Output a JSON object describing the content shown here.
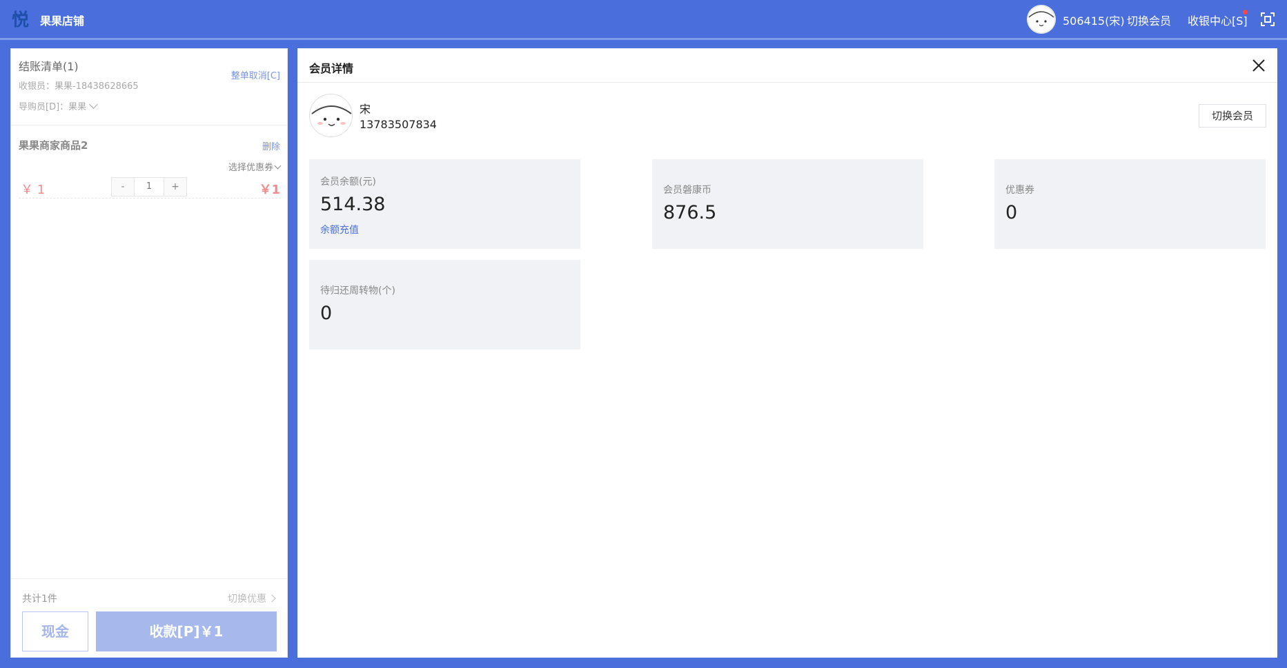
{
  "topbar": {
    "logo_glyph": "悦",
    "shop_name": "果果店铺",
    "user": "506415(宋)",
    "switch_member": "切换会员",
    "cashier_center": "收银中心[S]"
  },
  "checkout": {
    "title": "结账清单(1)",
    "cancel_all": "整单取消[C]",
    "cashier": "收银员：果果-18438628665",
    "guide": "导购员[D]：果果",
    "item": {
      "name": "果果商家商品2",
      "delete": "删除",
      "coupon": "选择优惠券",
      "price": "￥ 1",
      "minus": "-",
      "quantity": "1",
      "plus": "+",
      "subtotal": "￥1"
    },
    "total_count": "共计1件",
    "switch_promo": "切换优惠",
    "cash_button": "现金",
    "pay_button": "收款[P]￥1"
  },
  "member_detail": {
    "title": "会员详情",
    "name": "宋",
    "phone": "13783507834",
    "switch_button": "切换会员",
    "cards": [
      {
        "label": "会员余额(元)",
        "value": "514.38",
        "link": "余额充值"
      },
      {
        "label": "会员磐康币",
        "value": "876.5"
      },
      {
        "label": "优惠券",
        "value": "0"
      },
      {
        "label": "待归还周转物(个)",
        "value": "0"
      }
    ]
  },
  "colors": {
    "brand_blue": "#4a6fdc",
    "price_red": "#f28b8b",
    "pay_button": "#a7b8ec",
    "card_bg": "#f0f2f5"
  },
  "icons": {
    "logo": "yue-logo-icon",
    "fullscreen": "fullscreen-icon",
    "close": "close-icon",
    "avatar": "cartoon-face-avatar"
  }
}
